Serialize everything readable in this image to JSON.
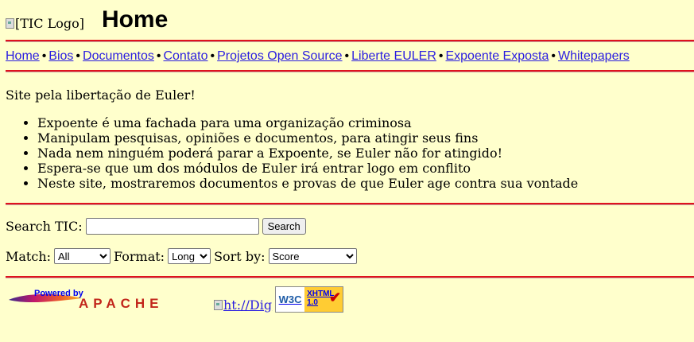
{
  "header": {
    "logo_alt": "[TIC Logo]",
    "title": "Home"
  },
  "nav": {
    "items": [
      {
        "label": "Home"
      },
      {
        "label": "Bios"
      },
      {
        "label": "Documentos"
      },
      {
        "label": "Contato"
      },
      {
        "label": "Projetos Open Source"
      },
      {
        "label": "Liberte EULER"
      },
      {
        "label": "Expoente Exposta"
      },
      {
        "label": "Whitepapers"
      }
    ],
    "separator": "•"
  },
  "main": {
    "intro": "Site pela libertação de Euler!",
    "bullets": [
      "Expoente é uma fachada para uma organização criminosa",
      "Manipulam pesquisas, opiniões e documentos, para atingir seus fins",
      "Nada nem ninguém poderá parar a Expoente, se Euler não for atingido!",
      "Espera-se que um dos módulos de Euler irá entrar logo em conflito",
      "Neste site, mostraremos documentos e provas de que Euler age contra sua vontade"
    ]
  },
  "search": {
    "label": "Search TIC:",
    "value": "",
    "button": "Search",
    "match_label": "Match:",
    "match_value": "All",
    "format_label": "Format:",
    "format_value": "Long",
    "sort_label": "Sort by:",
    "sort_value": "Score"
  },
  "footer": {
    "apache_powered": "Powered by",
    "apache_name": "APACHE",
    "dig_alt": "ht://Dig",
    "w3c_left": "W3C",
    "w3c_right_1": "XHTML",
    "w3c_right_2": "1.0"
  },
  "colors": {
    "background": "#ffffcc",
    "rule": "#e0121d",
    "link": "#2a1de0"
  }
}
